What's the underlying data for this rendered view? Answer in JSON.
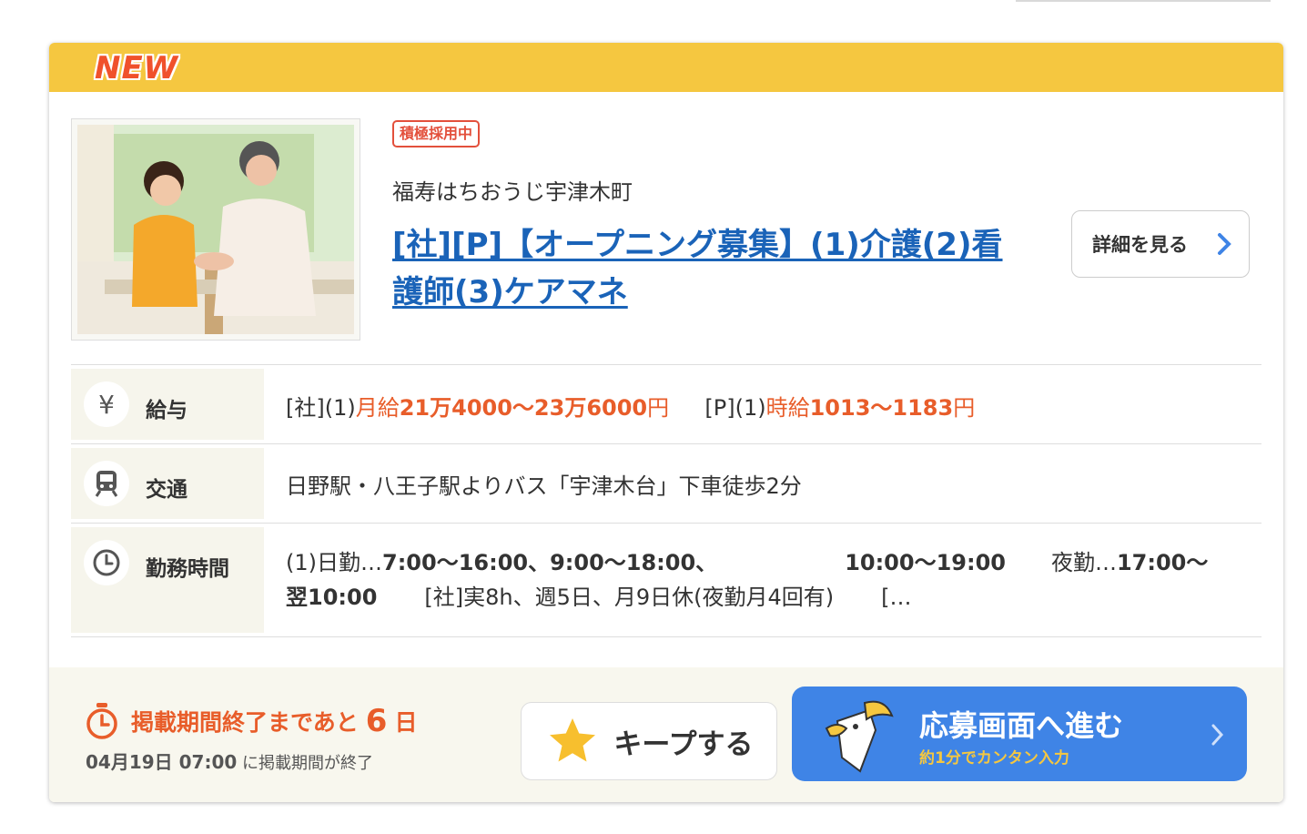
{
  "card": {
    "badge": "NEW",
    "hiring_tag": "積極採用中",
    "company": "福寿はちおうじ宇津木町",
    "title": "[社][P]【オープニング募集】(1)介護(2)看護師(3)ケアマネ",
    "detail_button": "詳細を見る"
  },
  "info": {
    "salary": {
      "label": "給与",
      "icon": "yen-icon",
      "p1": "[社](1)",
      "p2": "月給",
      "p3": "21万4000〜23万6000",
      "p4": "円",
      "p5": "[P](1)",
      "p6": "時給",
      "p7": "1013〜1183",
      "p8": "円"
    },
    "access": {
      "label": "交通",
      "icon": "train-icon",
      "text": "日野駅・八王子駅よりバス「宇津木台」下車徒歩2分"
    },
    "hours": {
      "label": "勤務時間",
      "icon": "clock-icon",
      "a1": "(1)日勤…",
      "a2": "7:00〜16:00、9:00〜18:00、",
      "a3": "10:00〜19:00",
      "a4": "夜勤…",
      "a5": "17:00〜",
      "b1": "翌10:00",
      "b2": "[社]実8h、週5日、月9日休(夜勤月4回有)",
      "b3": "[…"
    }
  },
  "footer": {
    "deadline_prefix": "掲載期間終了まであと",
    "deadline_days": "6",
    "deadline_unit": "日",
    "deadline_date": "04月19日 07:00",
    "deadline_suffix": "に掲載期間が終了",
    "keep_button": "キープする",
    "apply_main": "応募画面へ進む",
    "apply_sub": "約1分でカンタン入力"
  },
  "colors": {
    "band": "#f5c740",
    "link": "#1a63b8",
    "accent": "#e85d2a",
    "apply": "#3f84e6"
  }
}
